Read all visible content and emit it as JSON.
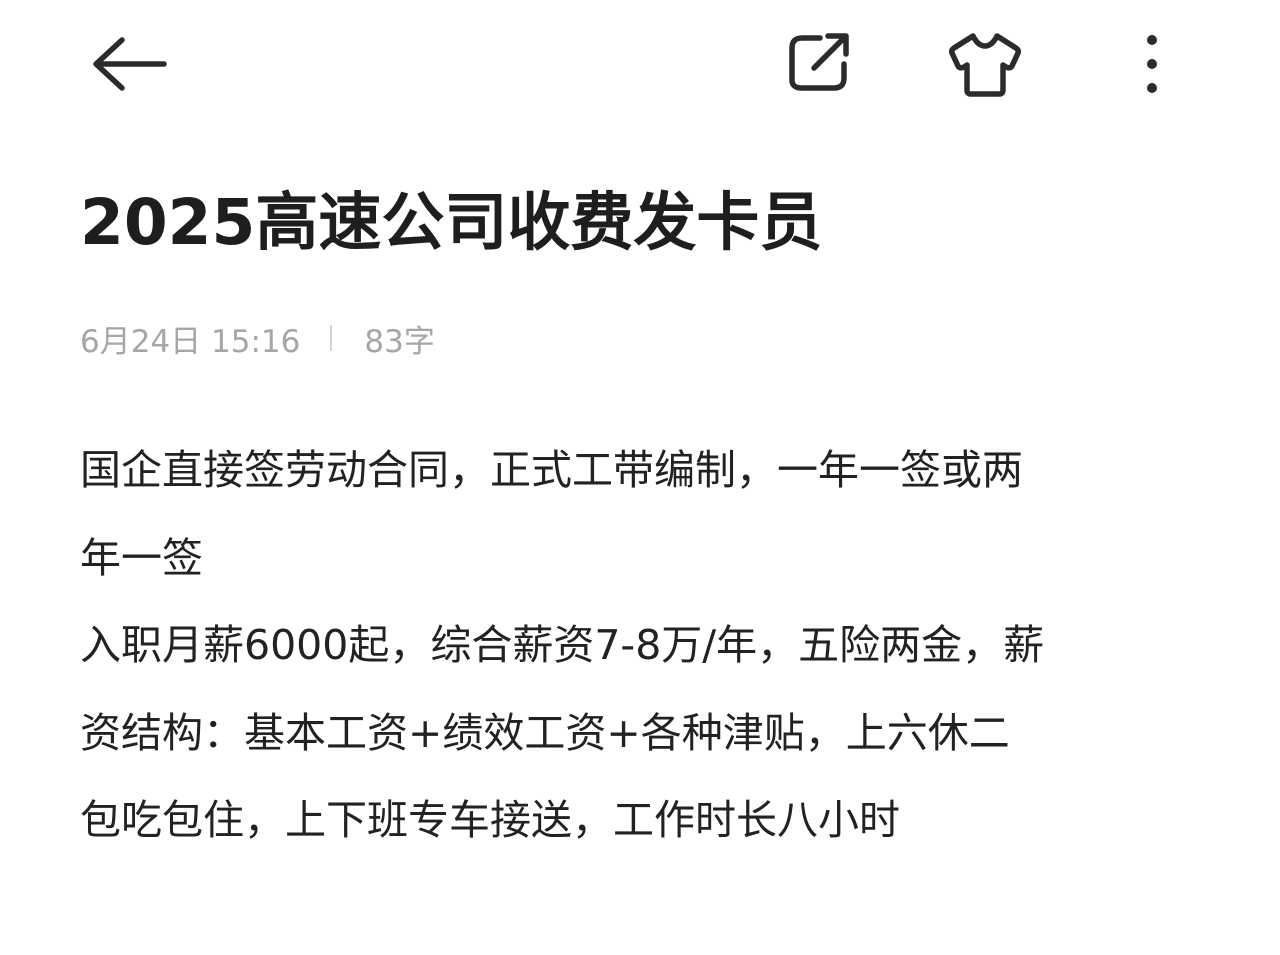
{
  "toolbar": {
    "back_icon": "arrow-left-icon",
    "share_icon": "share-external-icon",
    "theme_icon": "tshirt-icon",
    "more_icon": "more-vertical-icon"
  },
  "note": {
    "title": "2025高速公司收费发卡员",
    "date": "6月24日 15:16",
    "word_count": "83字",
    "body_lines": [
      "国企直接签劳动合同，正式工带编制，一年一签或两",
      "年一签",
      "入职月薪6000起，综合薪资7-8万/年，五险两金，薪",
      "资结构：基本工资+绩效工资+各种津贴，上六休二",
      "包吃包住，上下班专车接送，工作时长八小时"
    ]
  },
  "colors": {
    "background": "#ffffff",
    "title_text": "#1e1e1e",
    "body_text": "#222222",
    "meta_text": "#a6a6a6",
    "icon": "#2b2b2b"
  }
}
